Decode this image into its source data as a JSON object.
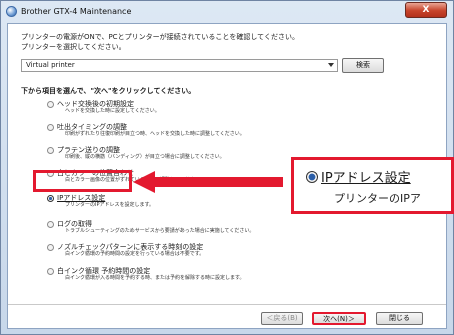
{
  "window": {
    "title": "Brother GTX-4 Maintenance",
    "close_label": "X"
  },
  "intro": {
    "line1": "プリンターの電源がONで、PCとプリンターが接続されていることを確認してください。",
    "line2": "プリンターを選択してください。"
  },
  "printer_select": {
    "value": "Virtual printer"
  },
  "search_button": {
    "label": "検索"
  },
  "heading": "下から項目を選んで、\"次へ\"をクリックしてください。",
  "options": [
    {
      "title": "ヘッド交換後の初期設定",
      "desc": "ヘッドを交換した時に設定してください。",
      "checked": false
    },
    {
      "title": "吐出タイミングの調整",
      "desc": "印刷がずれたり往復印刷が目立つ時、ヘッドを交換した時に調整してください。",
      "checked": false
    },
    {
      "title": "プラテン送りの調整",
      "desc": "印刷後、縦の横筋（バンディング）が目立つ場合に調整してください。",
      "checked": false
    },
    {
      "title": "白とカラーの位置合わせ",
      "desc": "白とカラー画像の位置がずれている場合に調整してください。",
      "checked": false
    },
    {
      "title": "IPアドレス設定",
      "desc": "プリンターのIPアドレスを設定します。",
      "checked": true
    },
    {
      "title": "ログの取得",
      "desc": "トラブルシューティングのためサービスから要請があった場合に実施してください。",
      "checked": false
    },
    {
      "title": "ノズルチェックパターンに表示する時刻の設定",
      "desc": "白インク循環の予約時間の設定を行っている場合は不要です。",
      "checked": false
    },
    {
      "title": "白インク循環 予約時間の設定",
      "desc": "白インク循環が入る時間を予約する時、または予約を解除する時に設定します。",
      "checked": false
    }
  ],
  "callout": {
    "title": "IPアドレス設定",
    "desc": "プリンターのIPア"
  },
  "footer": {
    "back_label": "＜戻る(B)",
    "next_label": "次へ(N)＞",
    "close_label": "閉じる"
  },
  "colors": {
    "highlight": "#e3192f",
    "accent": "#2c5fa8"
  }
}
